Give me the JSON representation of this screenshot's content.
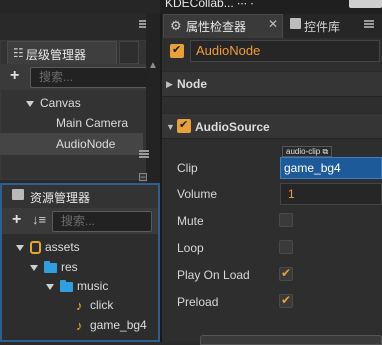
{
  "top_bar": {
    "text": "KDECollab... ∙∙∙ ∙"
  },
  "hierarchy": {
    "title": "层级管理器",
    "search_placeholder": "搜索...",
    "add_label": "+",
    "nodes": [
      {
        "label": "Canvas"
      },
      {
        "label": "Main Camera"
      },
      {
        "label": "AudioNode"
      }
    ]
  },
  "assets": {
    "title": "资源管理器",
    "search_placeholder": "搜索...",
    "add_label": "+",
    "sort_label": "↓≡",
    "tree": [
      {
        "label": "assets",
        "icon": "database-icon"
      },
      {
        "label": "res",
        "icon": "folder-icon"
      },
      {
        "label": "music",
        "icon": "folder-icon"
      },
      {
        "label": "click",
        "icon": "music-note-icon"
      },
      {
        "label": "game_bg4",
        "icon": "music-note-icon"
      }
    ]
  },
  "inspector": {
    "tab_inspector": "属性检查器",
    "tab_library": "控件库",
    "node_name": "AudioNode",
    "node_section": "Node",
    "component_section": "AudioSource",
    "props": {
      "clip_label": "Clip",
      "clip_badge": "audio-clip",
      "clip_value": "game_bg4",
      "volume_label": "Volume",
      "volume_value": "1",
      "mute_label": "Mute",
      "loop_label": "Loop",
      "playonload_label": "Play On Load",
      "preload_label": "Preload"
    },
    "states": {
      "node_enabled": true,
      "component_enabled": true,
      "mute": false,
      "loop": false,
      "play_on_load": true,
      "preload": true
    }
  },
  "colors": {
    "accent_orange": "#f29b3a",
    "selection_blue": "#1c5a9a",
    "panel_focus_border": "#2f5f8f",
    "folder_blue": "#2f9fe0"
  }
}
